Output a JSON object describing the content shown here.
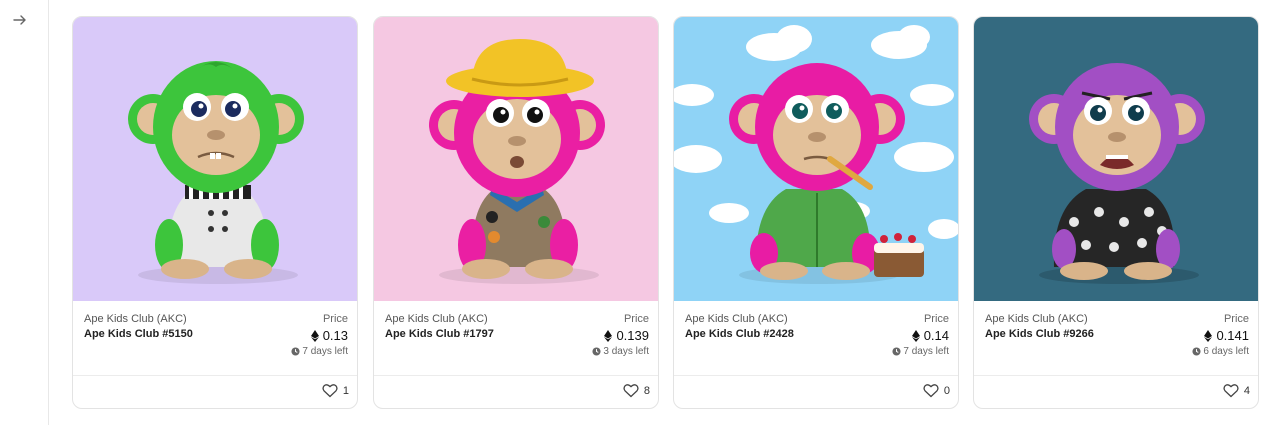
{
  "sidebar": {
    "expand_icon": "arrow-right-icon"
  },
  "cards": [
    {
      "collection": "Ape Kids Club (AKC)",
      "name": "Ape Kids Club #5150",
      "price_label": "Price",
      "price": "0.13",
      "time_left": "7 days left",
      "likes": "1",
      "colors": {
        "background": "#d9c9f9",
        "fur": "#3dc53c",
        "outfit": "#e8e8e8"
      }
    },
    {
      "collection": "Ape Kids Club (AKC)",
      "name": "Ape Kids Club #1797",
      "price_label": "Price",
      "price": "0.139",
      "time_left": "3 days left",
      "likes": "8",
      "colors": {
        "background": "#f5c8e2",
        "fur": "#ea1fa3",
        "outfit": "#8f7a60",
        "hat": "#f2c326"
      }
    },
    {
      "collection": "Ape Kids Club (AKC)",
      "name": "Ape Kids Club #2428",
      "price_label": "Price",
      "price": "0.14",
      "time_left": "7 days left",
      "likes": "0",
      "colors": {
        "background": "#8fd3f6",
        "fur": "#e81ca4",
        "outfit": "#4fa84a"
      }
    },
    {
      "collection": "Ape Kids Club (AKC)",
      "name": "Ape Kids Club #9266",
      "price_label": "Price",
      "price": "0.141",
      "time_left": "6 days left",
      "likes": "4",
      "colors": {
        "background": "#346a80",
        "fur": "#a24fc4",
        "outfit": "#262626"
      }
    }
  ]
}
